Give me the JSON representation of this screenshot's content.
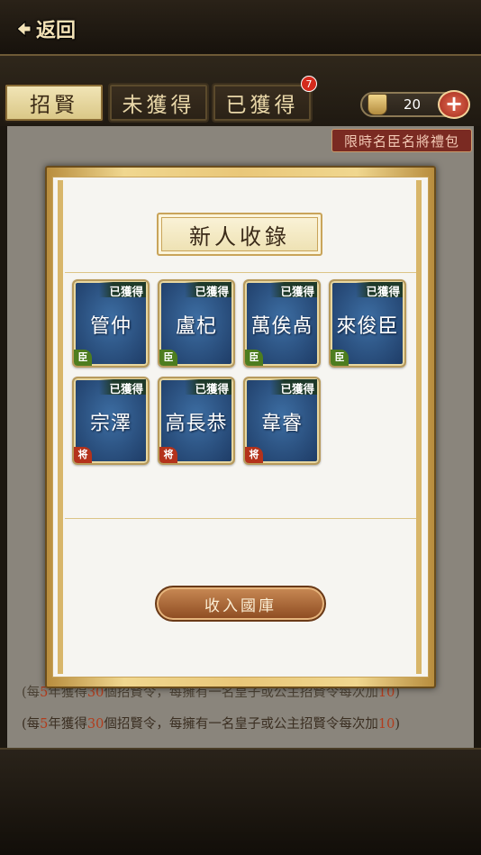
{
  "header": {
    "back_label": "返回"
  },
  "tabs": [
    {
      "label": "招賢",
      "active": true
    },
    {
      "label": "未獲得",
      "active": false
    },
    {
      "label": "已獲得",
      "active": false,
      "badge": "7"
    }
  ],
  "currency": {
    "value": "20",
    "add_label": "+"
  },
  "promo": "限時名臣名將禮包",
  "notes": [
    {
      "prefix": "(每",
      "n1": "5",
      "mid": "年獲得",
      "n2": "30",
      "rest": "個招賢令，每擁有一名皇子或公主招賢令每次加",
      "n3": "10",
      "end": ")"
    },
    {
      "prefix": "(每",
      "n1": "5",
      "mid": "年獲得",
      "n2": "30",
      "rest": "個招賢令，每擁有一名皇子或公主招賢令每次加",
      "n3": "10",
      "end": ")"
    }
  ],
  "modal": {
    "title": "新人收錄",
    "cards": [
      {
        "name": "管仲",
        "status": "已獲得",
        "type": "臣"
      },
      {
        "name": "盧杞",
        "status": "已獲得",
        "type": "臣"
      },
      {
        "name": "萬俟卨",
        "status": "已獲得",
        "type": "臣"
      },
      {
        "name": "來俊臣",
        "status": "已獲得",
        "type": "臣"
      },
      {
        "name": "宗澤",
        "status": "已獲得",
        "type": "将"
      },
      {
        "name": "高長恭",
        "status": "已獲得",
        "type": "将"
      },
      {
        "name": "韋睿",
        "status": "已獲得",
        "type": "将"
      }
    ],
    "button_label": "收入國庫"
  },
  "colors": {
    "accent_gold": "#e9c779",
    "card_blue": "#2a5080",
    "button_brown": "#a25e2e"
  }
}
